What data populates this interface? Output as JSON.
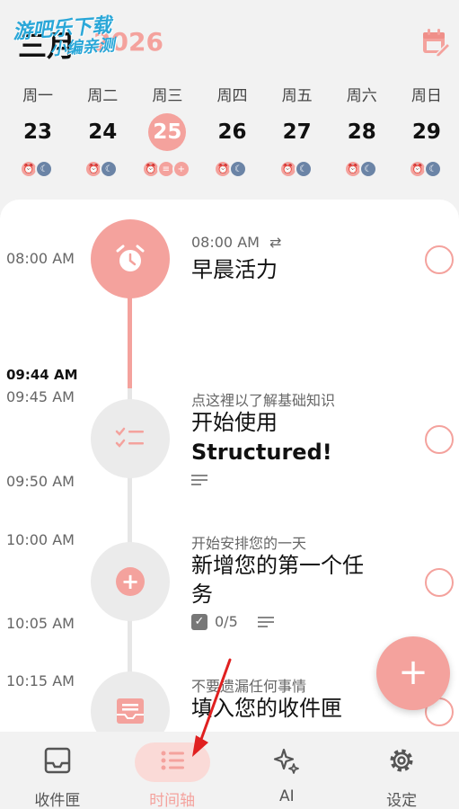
{
  "header": {
    "month": "三月",
    "year": "2026",
    "watermark_line1": "游吧乐下载",
    "watermark_line2": "小编亲测",
    "calendar_button_icon": "calendar-edit-icon"
  },
  "week": [
    {
      "name": "周一",
      "num": "23",
      "active": false
    },
    {
      "name": "周二",
      "num": "24",
      "active": false
    },
    {
      "name": "周三",
      "num": "25",
      "active": true
    },
    {
      "name": "周四",
      "num": "26",
      "active": false
    },
    {
      "name": "周五",
      "num": "27",
      "active": false
    },
    {
      "name": "周六",
      "num": "28",
      "active": false
    },
    {
      "name": "周日",
      "num": "29",
      "active": false
    }
  ],
  "timeline": {
    "times": [
      "08:00 AM",
      "09:44 AM",
      "09:45 AM",
      "09:50 AM",
      "10:00 AM",
      "10:05 AM",
      "10:15 AM"
    ],
    "tasks": [
      {
        "sub": "08:00 AM",
        "title": "早晨活力",
        "icon": "alarm-clock-icon"
      },
      {
        "sub": "点这裡以了解基础知识",
        "title_line1": "开始使用",
        "title_line2": "Structured!",
        "icon": "checklist-icon"
      },
      {
        "sub": "开始安排您的一天",
        "title_line1": "新增您的第一个任",
        "title_line2": "务",
        "subtasks": "0/5",
        "icon": "plus-icon"
      },
      {
        "sub": "不要遗漏任何事情",
        "title": "填入您的收件匣",
        "icon": "inbox-icon"
      }
    ]
  },
  "fab": {
    "label": "+"
  },
  "nav": [
    {
      "label": "收件匣",
      "icon": "inbox-icon"
    },
    {
      "label": "时间轴",
      "icon": "list-icon"
    },
    {
      "label": "AI",
      "icon": "sparkle-icon"
    },
    {
      "label": "设定",
      "icon": "gear-icon"
    }
  ],
  "colors": {
    "accent": "#f4a29d",
    "blue": "#6b84a6"
  }
}
